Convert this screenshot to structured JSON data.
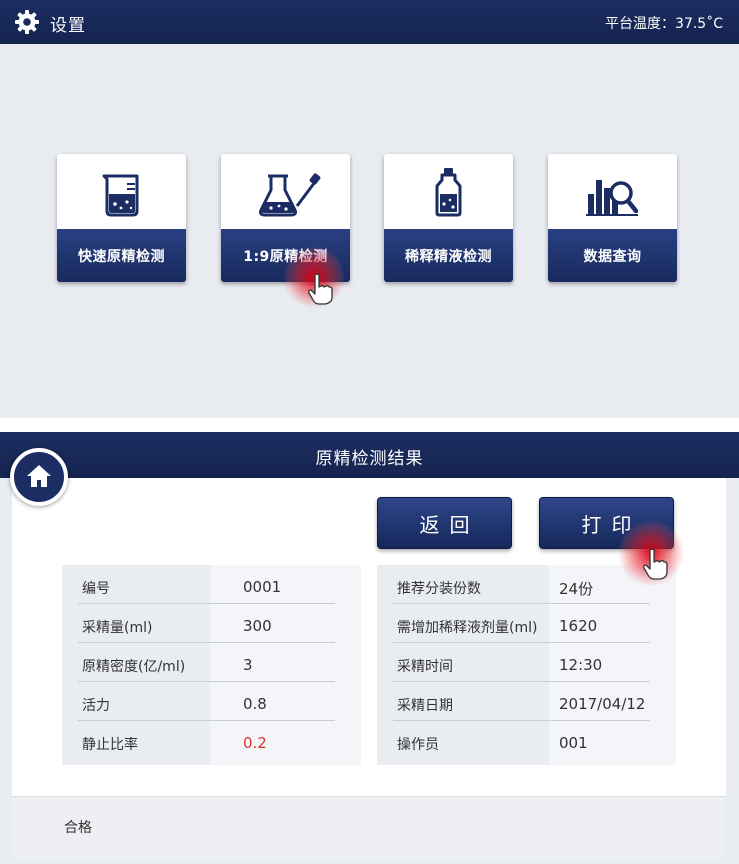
{
  "screen1": {
    "topbar": {
      "title": "设置",
      "temperature": "平台温度：37.5˚C"
    },
    "tiles": [
      {
        "label": "快速原精检测",
        "icon": "beaker-icon"
      },
      {
        "label": "1:9原精检测",
        "icon": "flask-dropper-icon"
      },
      {
        "label": "稀释精液检测",
        "icon": "bottle-icon"
      },
      {
        "label": "数据查询",
        "icon": "chart-search-icon"
      }
    ]
  },
  "screen2": {
    "title": "原精检测结果",
    "buttons": {
      "back": "返回",
      "print": "打印"
    },
    "left_table": [
      {
        "label": "编号",
        "value": "0001"
      },
      {
        "label": "采精量(ml)",
        "value": "300"
      },
      {
        "label": "原精密度(亿/ml)",
        "value": "3"
      },
      {
        "label": "活力",
        "value": "0.8"
      },
      {
        "label": "静止比率",
        "value": "0.2"
      }
    ],
    "right_table": [
      {
        "label": "推荐分装份数",
        "value": "24份"
      },
      {
        "label": "需增加稀释液剂量(ml)",
        "value": "1620"
      },
      {
        "label": "采精时间",
        "value": "12:30"
      },
      {
        "label": "采精日期",
        "value": "2017/04/12"
      },
      {
        "label": "操作员",
        "value": "001"
      }
    ],
    "footer": {
      "result": "合格"
    }
  },
  "colors": {
    "navy": "#1b2d63",
    "accent_red": "#d33333",
    "background": "#e8ebf0"
  }
}
